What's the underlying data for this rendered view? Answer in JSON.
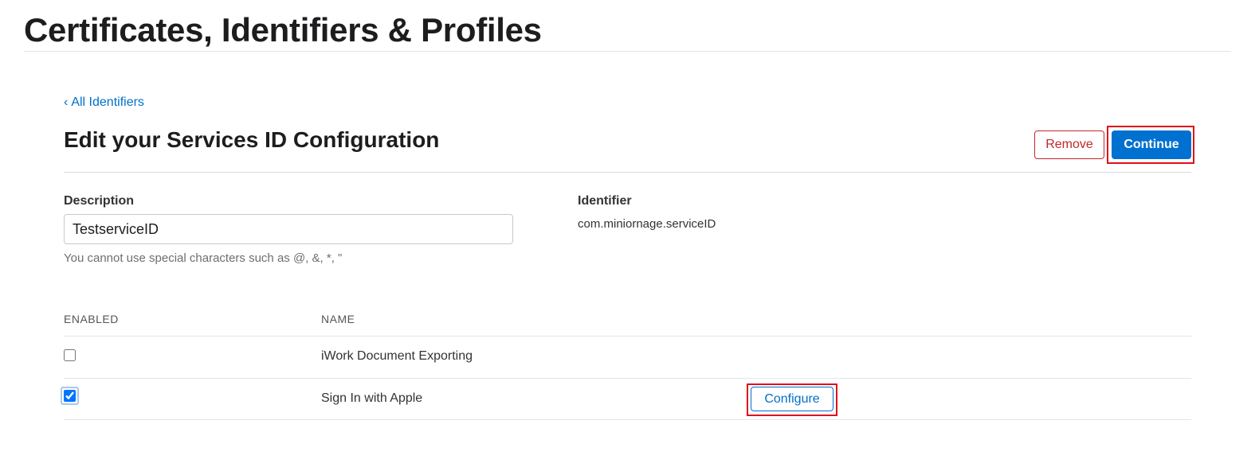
{
  "header": {
    "title": "Certificates, Identifiers & Profiles"
  },
  "nav": {
    "back_label": "All Identifiers"
  },
  "form": {
    "title": "Edit your Services ID Configuration",
    "remove_label": "Remove",
    "continue_label": "Continue",
    "description": {
      "label": "Description",
      "value": "TestserviceID",
      "hint": "You cannot use special characters such as @, &, *, \""
    },
    "identifier": {
      "label": "Identifier",
      "value": "com.miniornage.serviceID"
    }
  },
  "capabilities": {
    "columns": {
      "enabled": "ENABLED",
      "name": "NAME"
    },
    "rows": [
      {
        "name": "iWork Document Exporting",
        "enabled": false
      },
      {
        "name": "Sign In with Apple",
        "enabled": true,
        "action_label": "Configure"
      }
    ]
  },
  "colors": {
    "accent": "#0071d0",
    "link": "#0070c9",
    "danger": "#c1272d",
    "highlight_box": "#e0101a"
  }
}
